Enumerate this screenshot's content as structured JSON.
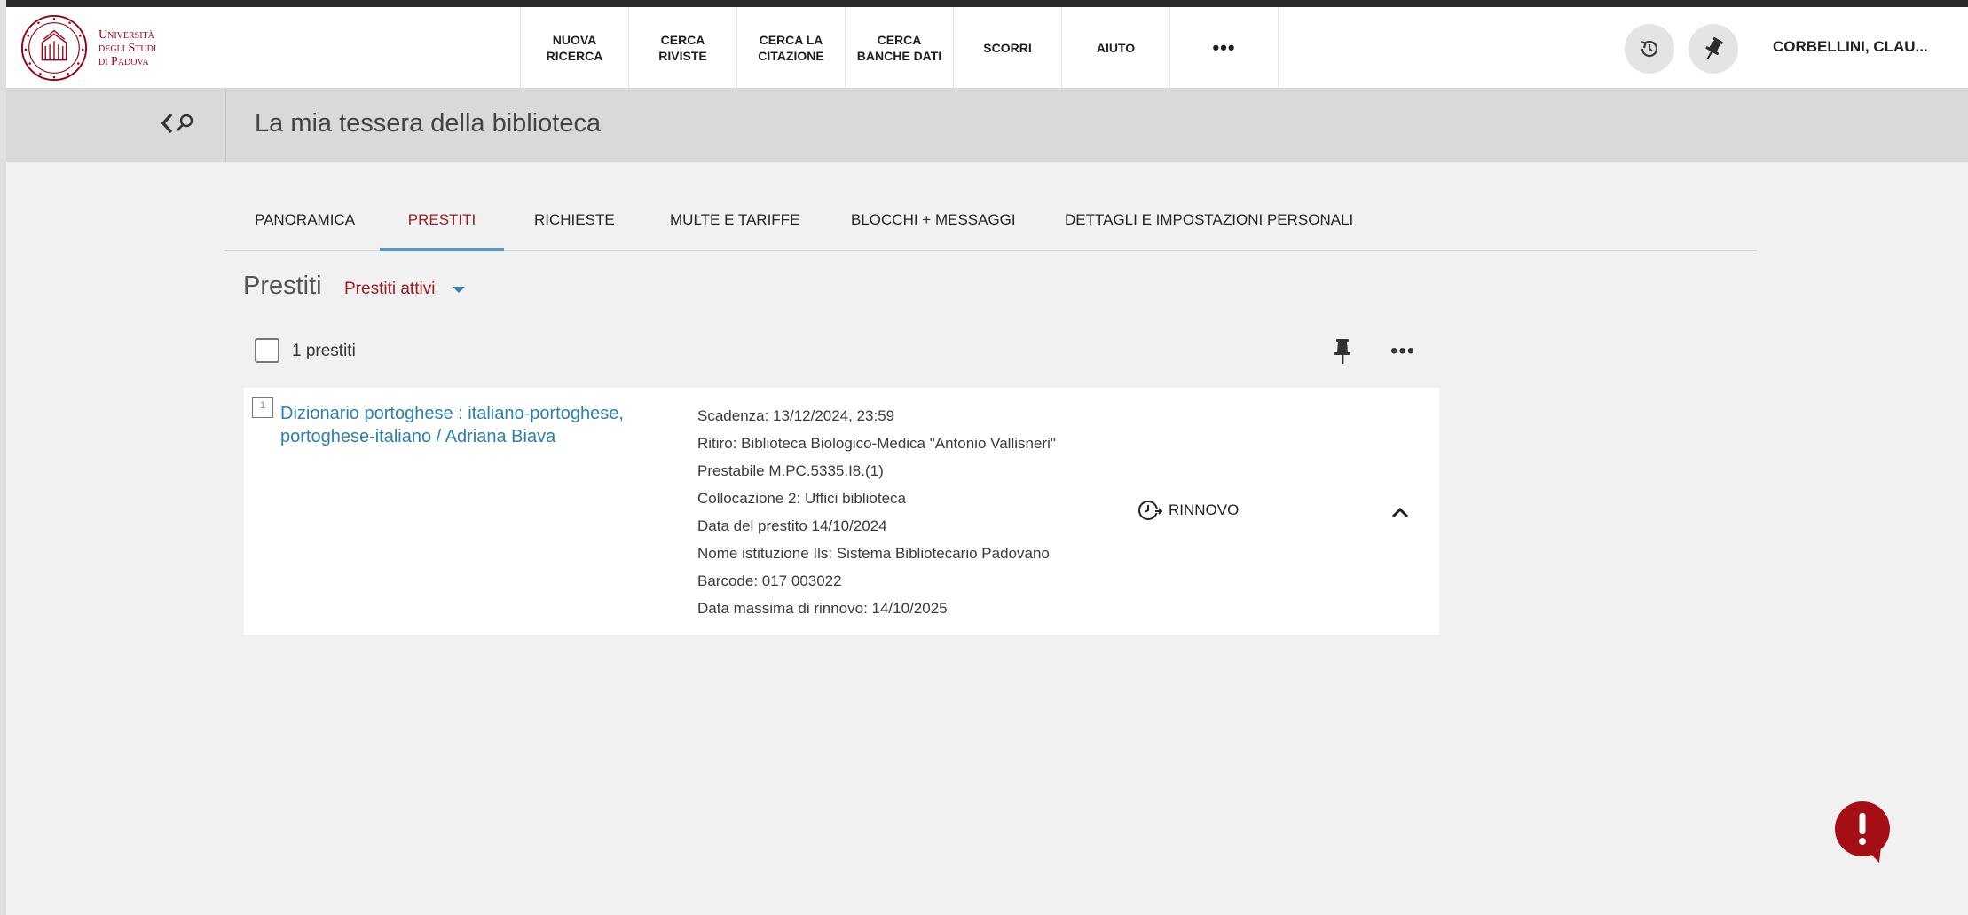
{
  "header": {
    "logo_lines": [
      "Università",
      "degli Studi",
      "di Padova"
    ],
    "nav": [
      {
        "label_lines": [
          "Nuova",
          "ricerca"
        ]
      },
      {
        "label_lines": [
          "Cerca",
          "riviste"
        ]
      },
      {
        "label_lines": [
          "Cerca la",
          "citazione"
        ]
      },
      {
        "label_lines": [
          "Cerca",
          "banche dati"
        ]
      },
      {
        "label_lines": [
          "Scorri"
        ]
      },
      {
        "label_lines": [
          "Aiuto"
        ]
      }
    ],
    "more_label": "•••",
    "user": "CORBELLINI, CLAU..."
  },
  "titlebar": {
    "title": "La mia tessera della biblioteca"
  },
  "tabs": [
    {
      "label": "Panoramica",
      "active": false
    },
    {
      "label": "Prestiti",
      "active": true
    },
    {
      "label": "Richieste",
      "active": false
    },
    {
      "label": "Multe e tariffe",
      "active": false
    },
    {
      "label": "Blocchi + messaggi",
      "active": false
    },
    {
      "label": "Dettagli e impostazioni personali",
      "active": false
    }
  ],
  "loans": {
    "section_title": "Prestiti",
    "filter_value": "Prestiti attivi",
    "count_label": "1 prestiti",
    "more_label": "•••",
    "items": [
      {
        "number": "1",
        "title": "Dizionario portoghese : italiano-portoghese, portoghese-italiano / Adriana Biava",
        "details": [
          "Scadenza: 13/12/2024, 23:59",
          "Ritiro: Biblioteca Biologico-Medica \"Antonio Vallisneri\" Prestabile M.PC.5335.I8.(1)",
          "Collocazione 2: Uffici biblioteca",
          "Data del prestito 14/10/2024",
          "Nome istituzione Ils: Sistema Bibliotecario Padovano",
          "Barcode: 017 003022",
          "Data massima di rinnovo: 14/10/2025"
        ],
        "renew_label": "Rinnovo"
      }
    ]
  },
  "colors": {
    "brand_red": "#9b1c23",
    "link_blue": "#2c7fb0",
    "tab_indicator": "#4a9ec9",
    "alert_red": "#a50e14"
  },
  "icons": {
    "history": "history-icon",
    "pin": "pin-icon",
    "back_search": "back-search-icon",
    "renew": "renew-clock-icon",
    "collapse": "chevron-up-icon",
    "alert": "alert-icon"
  }
}
